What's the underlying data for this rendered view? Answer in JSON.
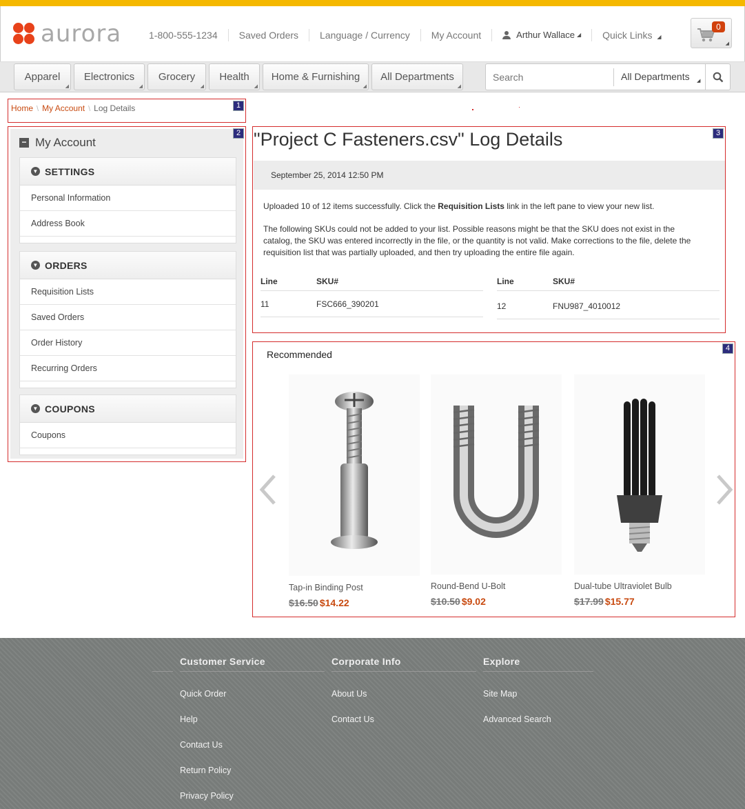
{
  "brand": {
    "name": "aurora",
    "accent": "#f5b800",
    "logo_color": "#e8421a"
  },
  "header": {
    "links": [
      "1-800-555-1234",
      "Saved Orders",
      "Language / Currency",
      "My Account"
    ],
    "user": "Arthur Wallace",
    "quick_links": "Quick Links",
    "cart_count": "0"
  },
  "nav": {
    "departments": [
      "Apparel",
      "Electronics",
      "Grocery",
      "Health",
      "Home & Furnishing",
      "All Departments"
    ],
    "search_placeholder": "Search",
    "search_scope": "All Departments"
  },
  "markers": [
    "1",
    "2",
    "3",
    "4"
  ],
  "breadcrumb": {
    "home": "Home",
    "account": "My Account",
    "current": "Log Details"
  },
  "sidebar": {
    "title": "My Account",
    "groups": [
      {
        "label": "SETTINGS",
        "items": [
          "Personal Information",
          "Address Book"
        ]
      },
      {
        "label": "ORDERS",
        "items": [
          "Requisition Lists",
          "Saved Orders",
          "Order History",
          "Recurring Orders"
        ]
      },
      {
        "label": "COUPONS",
        "items": [
          "Coupons"
        ]
      }
    ]
  },
  "log": {
    "title": "\"Project C Fasteners.csv\" Log Details",
    "date": "September 25, 2014 12:50 PM",
    "msg_pre": "Uploaded 10 of 12 items successfully. Click the ",
    "msg_link": "Requisition Lists",
    "msg_post": " link in the left pane to view your new list.",
    "msg2": "The following SKUs could not be added to your list. Possible reasons might be that the SKU does not exist in the catalog, the SKU was entered incorrectly in the file, or the quantity is not valid. Make corrections to the file, delete the requisition list that was partially uploaded, and then try uploading the entire file again.",
    "col_line": "Line",
    "col_sku": "SKU#",
    "rows": [
      {
        "line": "11",
        "sku": "FSC666_390201"
      },
      {
        "line": "12",
        "sku": "FNU987_4010012"
      }
    ]
  },
  "recommended": {
    "title": "Recommended",
    "products": [
      {
        "name": "Tap-in Binding Post",
        "old_price": "$16.50",
        "price": "$14.22",
        "icon": "binding-post-image"
      },
      {
        "name": "Round-Bend U-Bolt",
        "old_price": "$10.50",
        "price": "$9.02",
        "icon": "u-bolt-image"
      },
      {
        "name": "Dual-tube Ultraviolet Bulb",
        "old_price": "$17.99",
        "price": "$15.77",
        "icon": "uv-bulb-image"
      }
    ]
  },
  "footer": {
    "columns": [
      {
        "title": "Customer Service",
        "links": [
          "Quick Order",
          "Help",
          "Contact Us",
          "Return Policy",
          "Privacy Policy"
        ]
      },
      {
        "title": "Corporate Info",
        "links": [
          "About Us",
          "Contact Us"
        ]
      },
      {
        "title": "Explore",
        "links": [
          "Site Map",
          "Advanced Search"
        ]
      }
    ]
  }
}
